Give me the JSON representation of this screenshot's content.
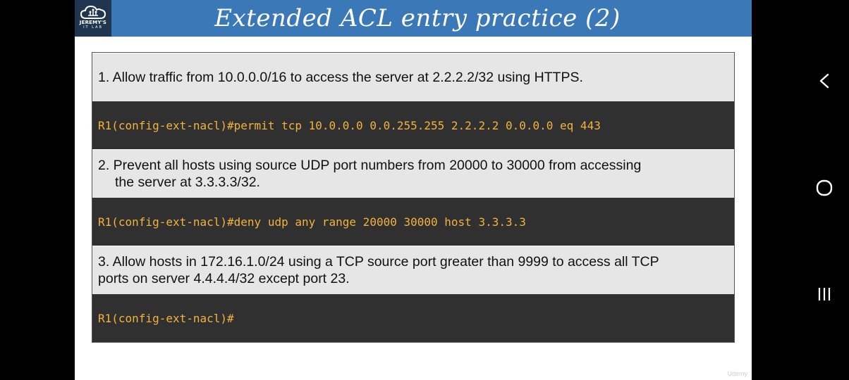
{
  "slide": {
    "logo": {
      "line1": "JEREMY'S",
      "line2": "IT LAB"
    },
    "title": "Extended ACL entry practice (2)",
    "watermark": "Udemy"
  },
  "entries": [
    {
      "question_line1": "1. Allow traffic from 10.0.0.0/16 to access the server at 2.2.2.2/32 using HTTPS.",
      "question_line2": "",
      "command": "R1(config-ext-nacl)#permit tcp 10.0.0.0 0.0.255.255 2.2.2.2 0.0.0.0 eq 443"
    },
    {
      "question_line1": "2. Prevent all hosts using source UDP port numbers from 20000 to 30000 from accessing",
      "question_line2": "the server at 3.3.3.3/32.",
      "command": "R1(config-ext-nacl)#deny udp any range 20000 30000 host 3.3.3.3"
    },
    {
      "question_line1": "3. Allow hosts in 172.16.1.0/24 using a TCP source port greater than 9999 to access all TCP",
      "question_line2": "ports on server 4.4.4.4/32 except port 23.",
      "command": "R1(config-ext-nacl)#"
    }
  ],
  "colors": {
    "title_bar": "#3a78b7",
    "question_bg": "#e7e6e6",
    "cli_bg": "#303030",
    "cli_text": "#f3b33c"
  },
  "android_nav": [
    "back-icon",
    "home-icon",
    "recents-icon"
  ]
}
